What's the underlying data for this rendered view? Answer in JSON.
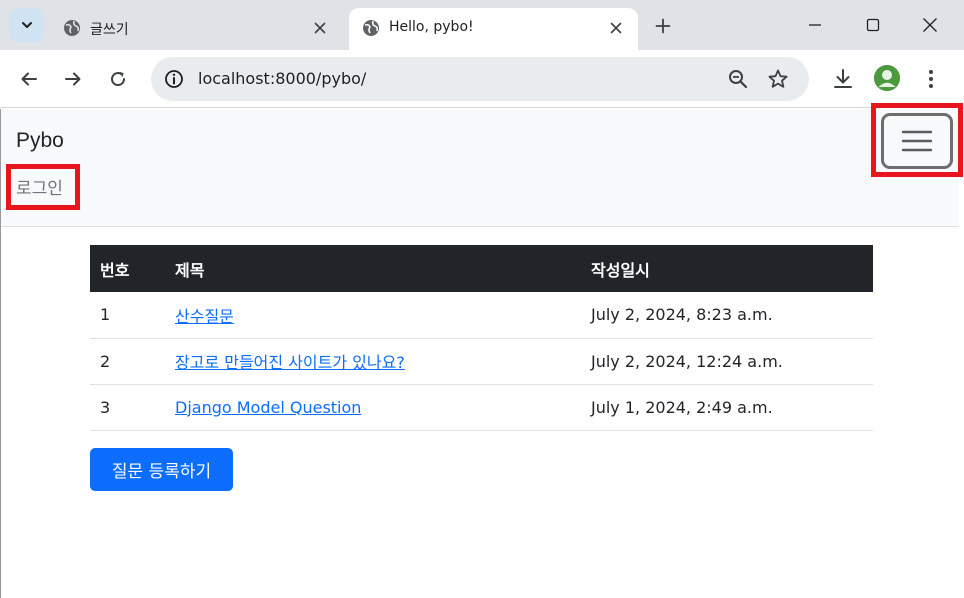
{
  "browser": {
    "tabs": [
      {
        "title": "글쓰기",
        "active": false
      },
      {
        "title": "Hello, pybo!",
        "active": true
      }
    ],
    "url": "localhost:8000/pybo/"
  },
  "navbar": {
    "brand": "Pybo",
    "login_label": "로그인"
  },
  "table": {
    "headers": [
      "번호",
      "제목",
      "작성일시"
    ],
    "rows": [
      {
        "no": "1",
        "subject": "산수질문",
        "created": "July 2, 2024, 8:23 a.m."
      },
      {
        "no": "2",
        "subject": "장고로 만들어진 사이트가 있나요?",
        "created": "July 2, 2024, 12:24 a.m."
      },
      {
        "no": "3",
        "subject": "Django Model Question",
        "created": "July 1, 2024, 2:49 a.m."
      }
    ]
  },
  "actions": {
    "register_label": "질문 등록하기"
  },
  "colors": {
    "highlight": "#e8161c",
    "primary": "#0d6efd",
    "table_header": "#212529"
  }
}
